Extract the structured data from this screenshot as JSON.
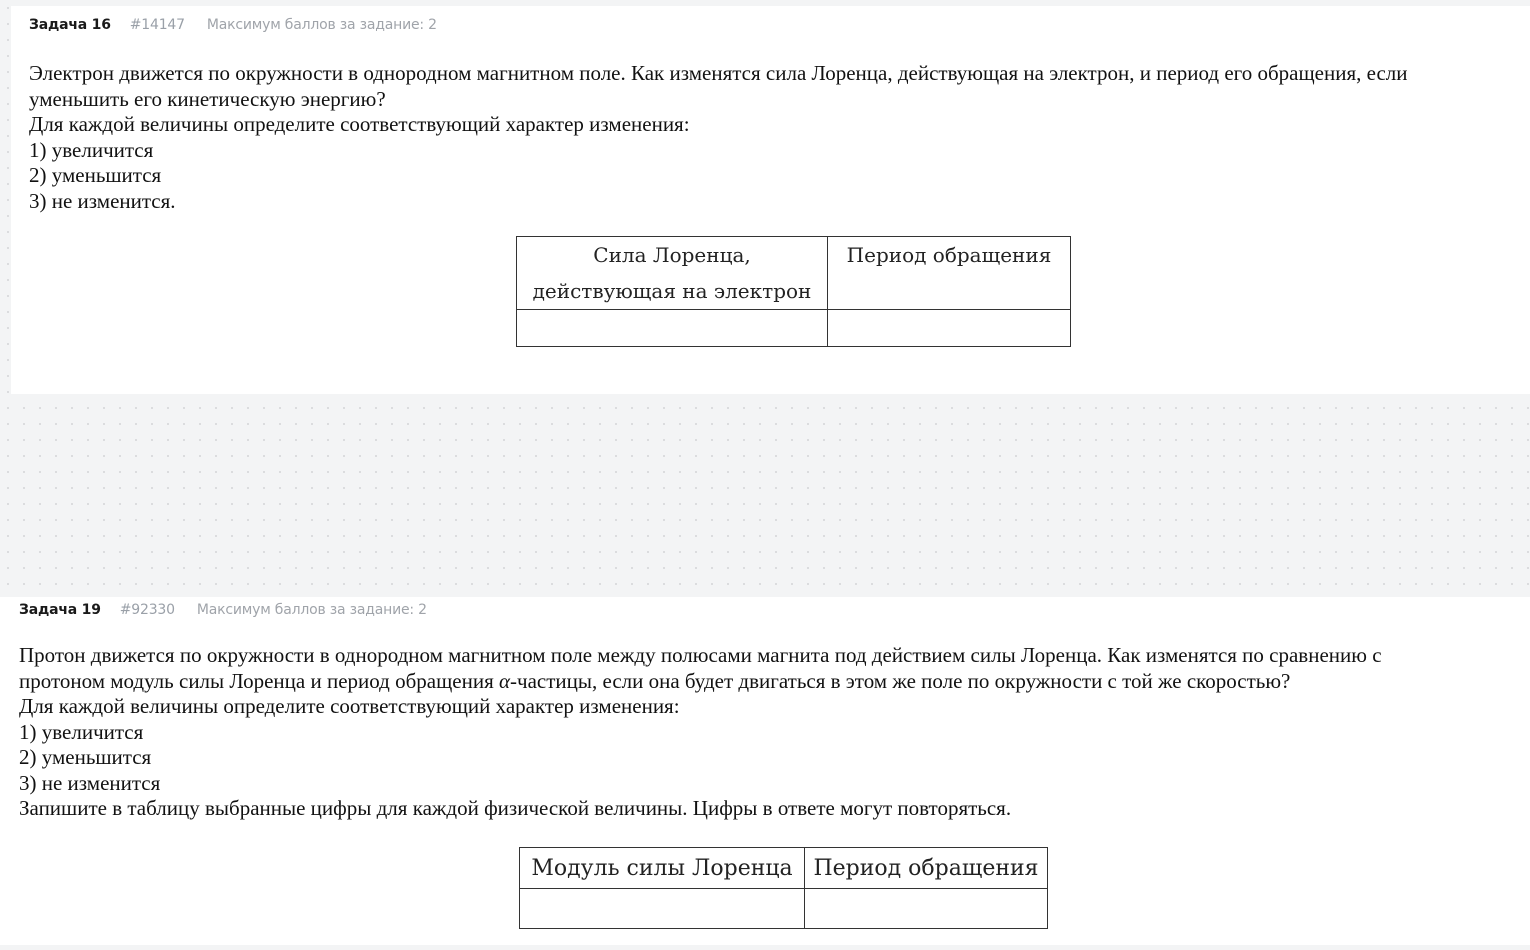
{
  "tasks": [
    {
      "title": "Задача 16",
      "number": "#14147",
      "max_points_label": "Максимум баллов за задание: 2",
      "lines": [
        "Электрон движется по окружности в однородном магнитном поле. Как изменятся сила Лоренца, действующая на электрон, и период его обращения, если",
        "уменьшить его кинетическую энергию?",
        "Для каждой величины определите соответствующий характер изменения:",
        "1) увеличится",
        "2) уменьшится",
        "3) не изменится."
      ],
      "table": {
        "col1_line1": "Сила Лоренца,",
        "col1_line2": "действующая на электрон",
        "col2": "Период обращения",
        "answer1": "",
        "answer2": ""
      }
    },
    {
      "title": "Задача 19",
      "number": "#92330",
      "max_points_label": "Максимум баллов за задание: 2",
      "line1": "Протон движется по окружности в однородном магнитном поле между полюсами магнита под действием силы Лоренца. Как изменятся по сравнению с",
      "line2_before": "протоном модуль силы Лоренца и период обращения ",
      "line2_symbol": "α",
      "line2_after": "-частицы, если она будет двигаться в этом же поле по окружности с той же скоростью?",
      "lines_rest": [
        "Для каждой величины определите соответствующий характер изменения:",
        "1) увеличится",
        "2) уменьшится",
        "3) не изменится",
        "Запишите в таблицу выбранные цифры для каждой физической величины. Цифры в ответе могут повторяться."
      ],
      "table": {
        "col1": "Модуль силы Лоренца",
        "col2": "Период обращения",
        "answer1": "",
        "answer2": ""
      }
    }
  ]
}
